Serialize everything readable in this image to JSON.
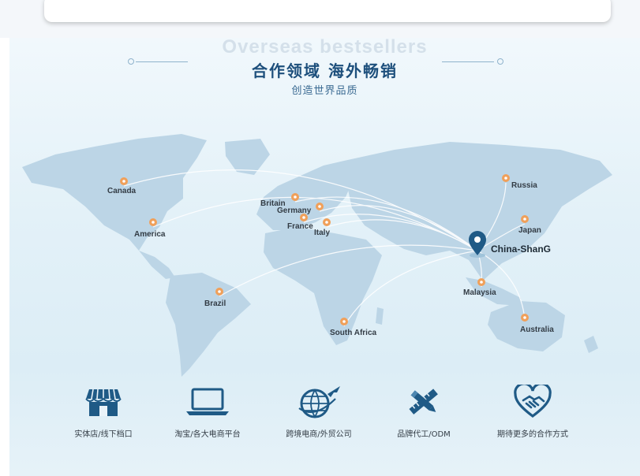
{
  "header": {
    "bg_title": "Overseas bestsellers",
    "title": "合作领域 海外畅销",
    "subtitle": "创造世界品质"
  },
  "map": {
    "hub": "China-ShanG",
    "locations": {
      "canada": "Canada",
      "america": "America",
      "britain": "Britain",
      "germany": "Germany",
      "france": "France",
      "italy": "Italy",
      "brazil": "Brazil",
      "south_africa": "South Africa",
      "russia": "Russia",
      "japan": "Japan",
      "malaysia": "Malaysia",
      "australia": "Australia"
    }
  },
  "features": [
    {
      "id": "store",
      "icon": "storefront-icon",
      "label": "实体店/线下档口"
    },
    {
      "id": "ecommerce",
      "icon": "laptop-icon",
      "label": "淘宝/各大电商平台"
    },
    {
      "id": "crossborder",
      "icon": "globe-plane-icon",
      "label": "跨境电商/外贸公司"
    },
    {
      "id": "oem",
      "icon": "pencil-ruler-icon",
      "label": "品牌代工/ODM"
    },
    {
      "id": "more",
      "icon": "handshake-heart-icon",
      "label": "期待更多的合作方式"
    }
  ],
  "colors": {
    "accent": "#1d4f7c",
    "pin": "#f0a05a",
    "hub_pin": "#1f5a86",
    "land": "#bcd5e6"
  }
}
